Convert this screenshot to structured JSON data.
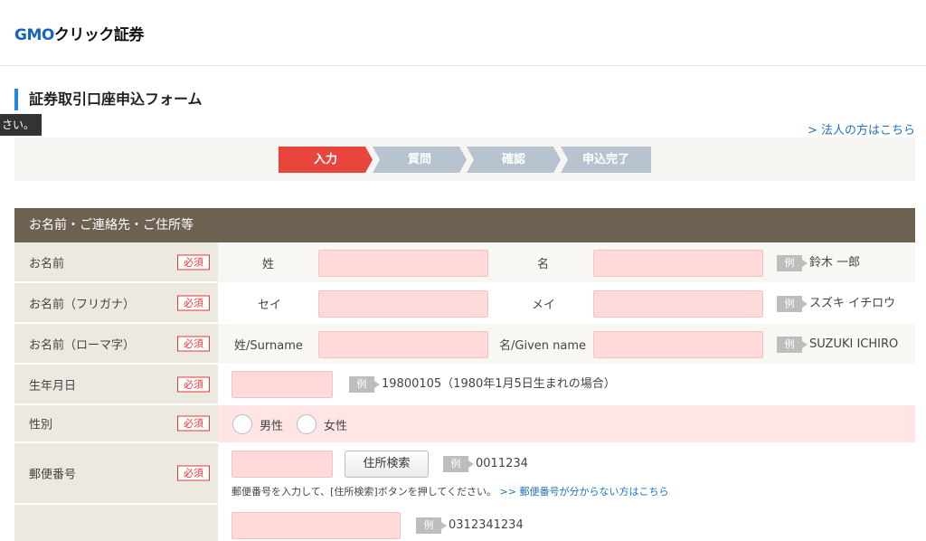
{
  "logo": {
    "gmo": "GMO",
    "rest": "クリック証券"
  },
  "page_title": "証券取引口座申込フォーム",
  "tooltip": "さい。",
  "corp_link": "> 法人の方はこちら",
  "steps": [
    {
      "label": "入力",
      "active": true
    },
    {
      "label": "質問",
      "active": false
    },
    {
      "label": "確認",
      "active": false
    },
    {
      "label": "申込完了",
      "active": false
    }
  ],
  "colors": {
    "active_step": "#e8453c",
    "inactive_step": "#b7c4cf",
    "section_head": "#6d6152",
    "required": "#e53935",
    "input_bg": "#ffdada"
  },
  "section_title": "お名前・ご連絡先・ご住所等",
  "required_label": "必須",
  "example_label": "例",
  "rows": {
    "name": {
      "label": "お名前",
      "sub1": "姓",
      "sub2": "名",
      "example": "鈴木 一郎"
    },
    "kana": {
      "label": "お名前（フリガナ）",
      "sub1": "セイ",
      "sub2": "メイ",
      "example": "スズキ イチロウ"
    },
    "roman": {
      "label": "お名前（ローマ字）",
      "sub1": "姓/Surname",
      "sub2": "名/Given name",
      "example": "SUZUKI ICHIRO"
    },
    "birth": {
      "label": "生年月日",
      "example": "19800105（1980年1月5日生まれの場合）"
    },
    "gender": {
      "label": "性別",
      "male": "男性",
      "female": "女性"
    },
    "postal": {
      "label": "郵便番号",
      "button": "住所検索",
      "example": "0011234",
      "note": "郵便番号を入力して、[住所検索]ボタンを押してください。",
      "note_link": ">> 郵便番号が分からない方はこちら"
    },
    "phone": {
      "example": "0312341234"
    }
  }
}
